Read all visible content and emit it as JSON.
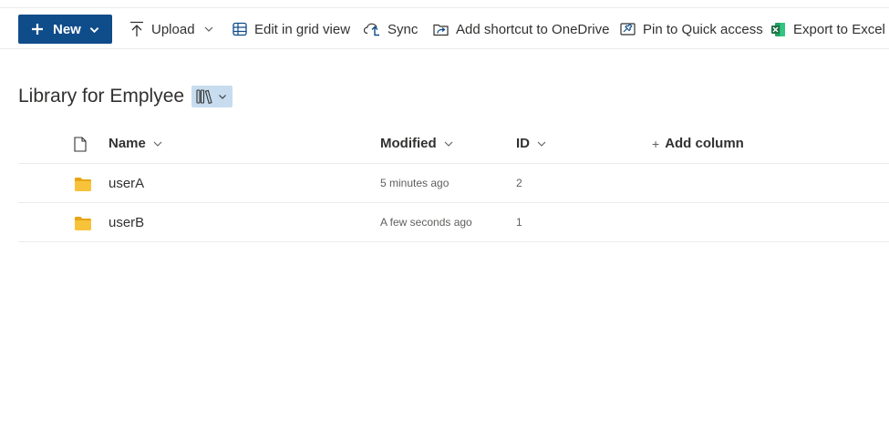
{
  "commandbar": {
    "new_label": "New",
    "upload_label": "Upload",
    "grid_label": "Edit in grid view",
    "sync_label": "Sync",
    "shortcut_label": "Add shortcut to OneDrive",
    "pin_label": "Pin to Quick access",
    "export_label": "Export to Excel"
  },
  "library": {
    "title": "Library for Emplyee",
    "view_icon": "library-icon"
  },
  "columns": {
    "type_icon": "file-icon",
    "name": "Name",
    "modified": "Modified",
    "id": "ID",
    "add_column": "Add column"
  },
  "rows": [
    {
      "name": "userA",
      "modified": "5 minutes ago",
      "id": "2",
      "icon": "folder-icon"
    },
    {
      "name": "userB",
      "modified": "A few seconds ago",
      "id": "1",
      "icon": "folder-icon"
    }
  ],
  "colors": {
    "accent": "#0f4c8a",
    "view_button_bg": "#c7dcef",
    "folder": "#f8c33a",
    "excel": "#1d6f42"
  }
}
